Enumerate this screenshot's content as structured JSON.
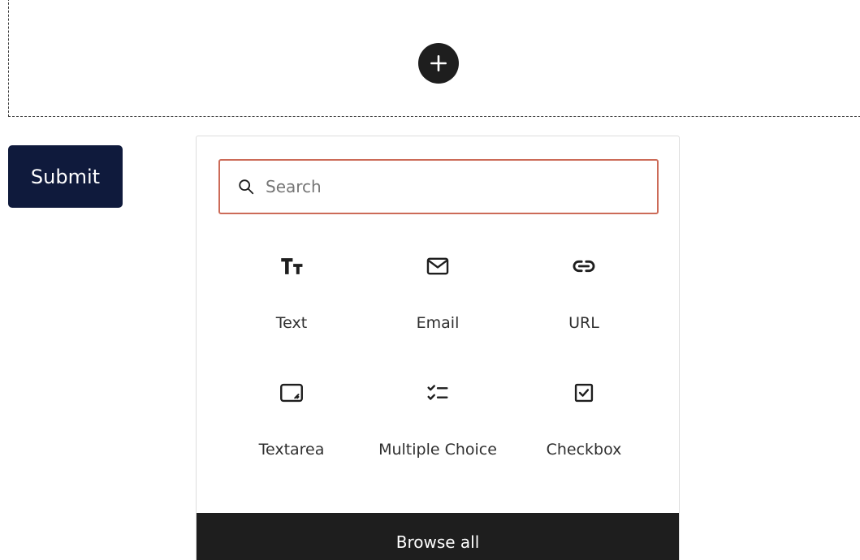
{
  "placeholder": {
    "add_button_icon": "plus-icon"
  },
  "submit_label": "Submit",
  "inserter": {
    "search": {
      "placeholder": "Search",
      "value": "",
      "icon": "search-icon"
    },
    "blocks": [
      {
        "label": "Text",
        "icon": "text-icon"
      },
      {
        "label": "Email",
        "icon": "email-icon"
      },
      {
        "label": "URL",
        "icon": "link-icon"
      },
      {
        "label": "Textarea",
        "icon": "textarea-icon"
      },
      {
        "label": "Multiple Choice",
        "icon": "multiple-choice-icon"
      },
      {
        "label": "Checkbox",
        "icon": "checkbox-icon"
      }
    ],
    "browse_all_label": "Browse all"
  },
  "colors": {
    "submit_bg": "#0f1a3c",
    "search_border": "#cc6b58",
    "browse_bar_bg": "#1e1e1e"
  }
}
